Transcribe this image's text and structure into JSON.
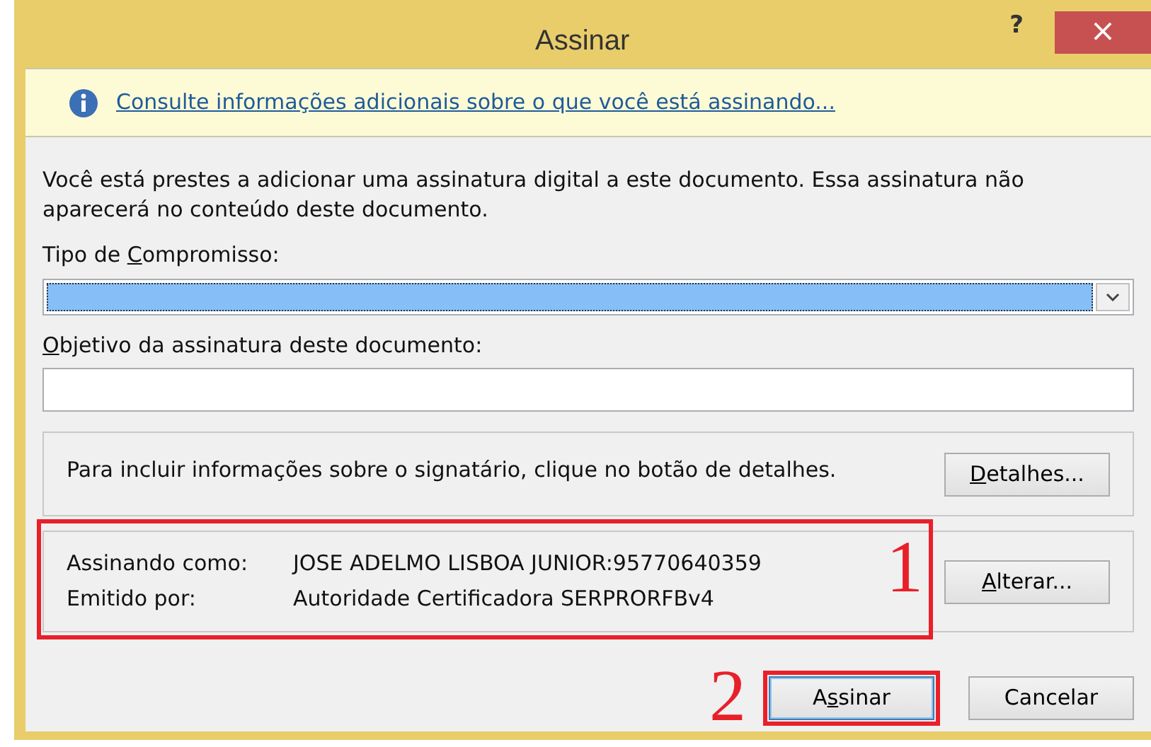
{
  "window": {
    "title": "Assinar",
    "help": "?",
    "close": "×"
  },
  "info_bar": {
    "link": "Consulte informações adicionais sobre o que você está assinando..."
  },
  "description": "Você está prestes a adicionar uma assinatura digital a este documento. Essa assinatura não aparecerá no conteúdo deste documento.",
  "fields": [
    {
      "kind": "combo",
      "label": {
        "before": "Tipo de ",
        "key": "C",
        "after": "ompromisso:"
      },
      "focused": true
    },
    {
      "kind": "text",
      "label": {
        "key": "O",
        "after": "bjetivo da assinatura deste documento:"
      },
      "focused": false
    }
  ],
  "details_group": {
    "text": "Para incluir informações sobre o signatário, clique no botão de detalhes.",
    "button": {
      "key": "D",
      "after": "etalhes..."
    }
  },
  "signer_group": {
    "rows": [
      {
        "label": "Assinando como:",
        "value": "JOSE ADELMO LISBOA JUNIOR:95770640359"
      },
      {
        "label": "Emitido por:",
        "value": "Autoridade Certificadora SERPRORFBv4"
      }
    ],
    "button": {
      "key": "A",
      "after": "lterar..."
    },
    "annotation": "1"
  },
  "buttons": [
    {
      "label": {
        "before": "A",
        "key": "s",
        "after": "sinar"
      },
      "default": true,
      "annotation": "2"
    },
    {
      "label": {
        "before": "Cancelar"
      },
      "default": false
    }
  ]
}
